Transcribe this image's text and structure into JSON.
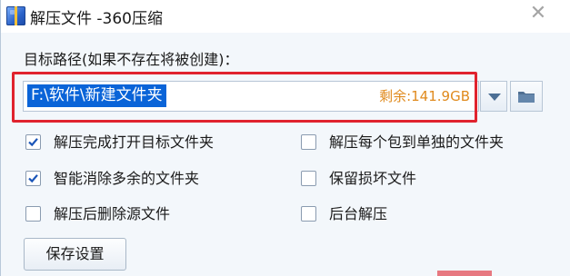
{
  "window": {
    "title": "解压文件 -360压缩",
    "close_glyph": "✕"
  },
  "path": {
    "caption": "目标路径(如果不存在将被创建)：",
    "value": "F:\\软件\\新建文件夹",
    "free_space": "剩余:141.9GB"
  },
  "options": [
    {
      "label": "解压完成打开目标文件夹",
      "checked": true
    },
    {
      "label": "解压每个包到单独的文件夹",
      "checked": false
    },
    {
      "label": "智能消除多余的文件夹",
      "checked": true
    },
    {
      "label": "保留损坏文件",
      "checked": false
    },
    {
      "label": "解压后删除源文件",
      "checked": false
    },
    {
      "label": "后台解压",
      "checked": false
    }
  ],
  "buttons": {
    "save_settings": "保存设置"
  },
  "colors": {
    "accent_blue": "#2a62c9",
    "highlight_red": "#e0232e",
    "free_space_orange": "#e08a1d",
    "selection_blue": "#0a64d8"
  },
  "icons": {
    "app": "360zip-app-icon",
    "close": "close-icon",
    "dropdown": "chevron-down-icon",
    "browse": "folder-icon",
    "check": "checkmark-icon"
  }
}
